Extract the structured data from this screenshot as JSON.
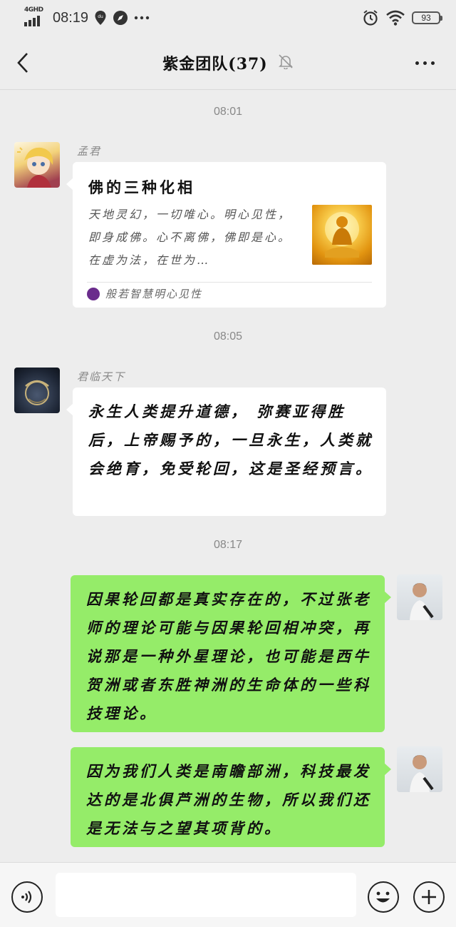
{
  "status_bar": {
    "network_label": "4GHD",
    "time": "08:19",
    "battery": "93"
  },
  "chat": {
    "title": "紫金团队(37)",
    "icons": {
      "back": "chevron-left-icon",
      "mute": "bell-muted-icon",
      "more": "more-dots-icon"
    }
  },
  "messages": [
    {
      "time": "08:01",
      "sender": "孟君",
      "type": "link-card",
      "card": {
        "title": "佛的三种化相",
        "description": "天地灵幻，一切唯心。明心见性，即身成佛。心不离佛，佛即是心。在虚为法，在世为…",
        "source": "般若智慧明心见性"
      }
    },
    {
      "time": "08:05",
      "sender": "君临天下",
      "type": "text",
      "text": "永生人类提升道德， 弥赛亚得胜后，上帝赐予的，一旦永生，人类就会绝育，免受轮回，这是圣经预言。"
    },
    {
      "time": "08:17",
      "sender": "me",
      "type": "text",
      "text": "因果轮回都是真实存在的，不过张老师的理论可能与因果轮回相冲突，再说那是一种外星理论，也可能是西牛贺洲或者东胜神洲的生命体的一些科技理论。"
    },
    {
      "sender": "me",
      "type": "text",
      "text": "因为我们人类是南瞻部洲，科技最发达的是北俱芦洲的生物，所以我们还是无法与之望其项背的。"
    }
  ],
  "input_bar": {
    "placeholder": "",
    "icons": [
      "voice-icon",
      "emoji-icon",
      "plus-icon"
    ]
  },
  "colors": {
    "background": "#ededed",
    "incoming_bubble": "#ffffff",
    "outgoing_bubble": "#95ec69",
    "timestamp": "#888888"
  }
}
